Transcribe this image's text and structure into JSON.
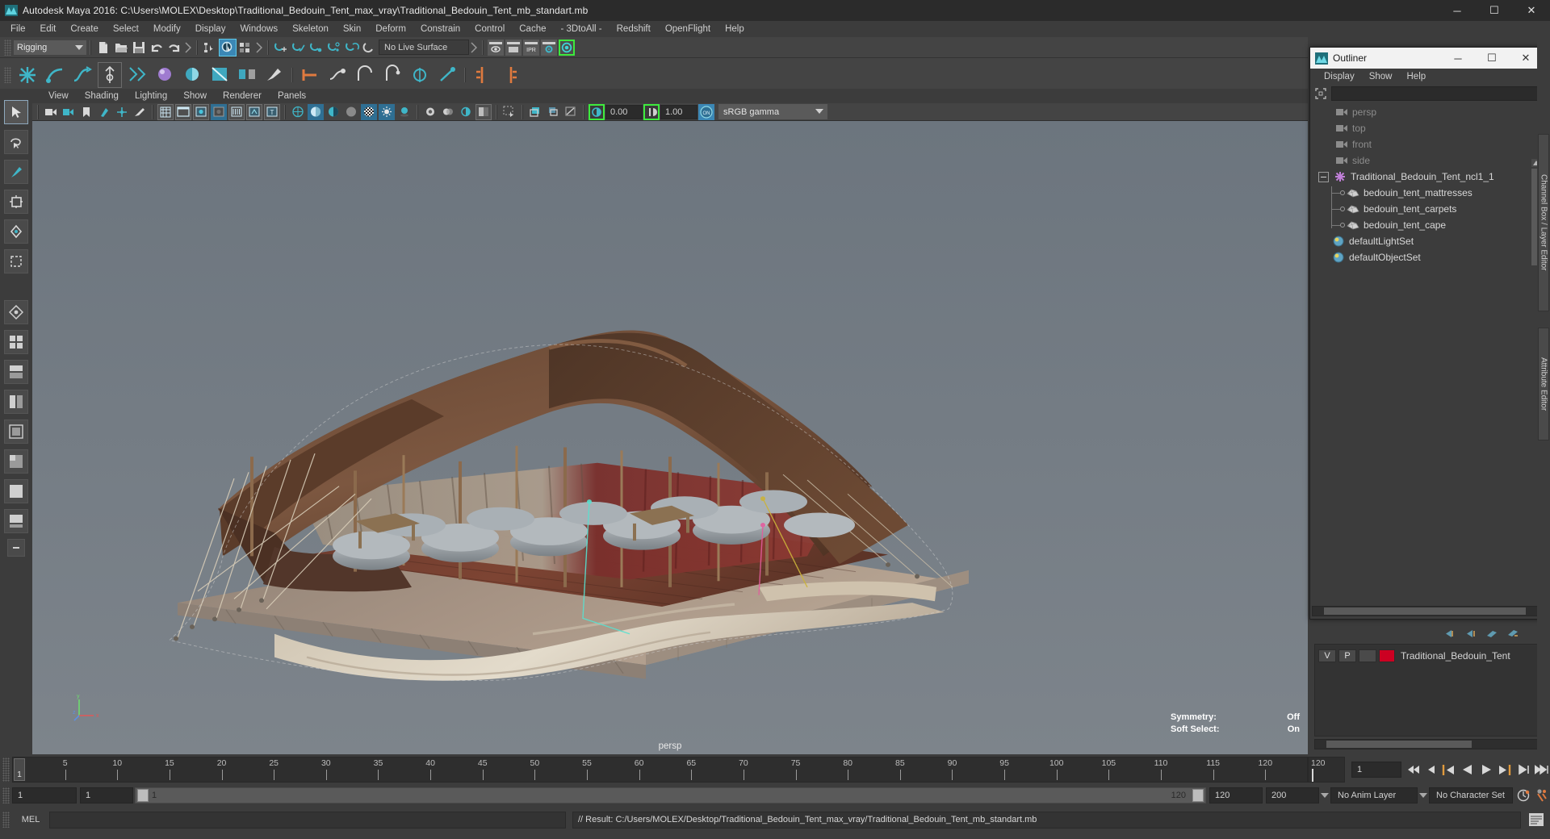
{
  "window": {
    "title": "Autodesk Maya 2016: C:\\Users\\MOLEX\\Desktop\\Traditional_Bedouin_Tent_max_vray\\Traditional_Bedouin_Tent_mb_standart.mb",
    "app_icon": "maya-icon",
    "minimize": "─",
    "maximize": "☐",
    "close": "✕"
  },
  "menubar": {
    "items": [
      "File",
      "Edit",
      "Create",
      "Select",
      "Modify",
      "Display",
      "Windows",
      "Skeleton",
      "Skin",
      "Deform",
      "Constrain",
      "Control",
      "Cache",
      "- 3DtoAll -",
      "Redshift",
      "OpenFlight",
      "Help"
    ]
  },
  "statusline": {
    "menuset_value": "Rigging",
    "live_surface": "No Live Surface",
    "icons": [
      "new-scene-icon",
      "open-scene-icon",
      "save-scene-icon",
      "undo-icon",
      "redo-icon",
      "select-by-hierarchy-icon",
      "select-by-object-icon",
      "select-by-component-icon",
      "snap-to-grid-icon",
      "snap-to-curve-icon",
      "snap-to-point-icon",
      "snap-to-projected-center-icon",
      "snap-to-view-planes-icon",
      "make-live-icon"
    ],
    "render_icons": [
      "render-current-frame-icon",
      "render-sequence-icon",
      "ipr-render-icon",
      "render-settings-icon",
      "render-globals-icon"
    ],
    "ipr_label": "IPR"
  },
  "shelf": {
    "icons": [
      "joint-tool-icon",
      "ik-handle-tool-icon",
      "ik-spline-handle-icon",
      "insert-joint-tool-icon",
      "skeleton-tool-icon",
      "bind-skin-icon",
      "interactive-bind-icon",
      "smooth-bind-icon",
      "detach-skin-icon",
      "paint-weights-icon",
      "parent-constraint-icon",
      "point-constraint-icon",
      "orient-constraint-icon",
      "scale-constraint-icon",
      "aim-constraint-icon",
      "pole-vector-icon",
      "mirror-joint-icon",
      "orient-joint-icon"
    ]
  },
  "toolbox": {
    "tools": [
      "select-tool",
      "lasso-select-tool",
      "paint-select-tool",
      "move-tool",
      "rotate-tool",
      "scale-tool",
      "last-tool-used",
      "four-view-layout",
      "persp-outliner-layout",
      "persp-graph-layout",
      "hypershade-persp-layout",
      "persp-view-layout",
      "single-perspective-view",
      "two-pane-layout",
      "more-layouts"
    ],
    "active_tool": "select-tool"
  },
  "viewport": {
    "menus": [
      "View",
      "Shading",
      "Lighting",
      "Show",
      "Renderer",
      "Panels"
    ],
    "toolbar_icons": [
      "select-camera-icon",
      "camera-attributes-icon",
      "bookmark-icon",
      "image-plane-icon",
      "two-dimensional-pan-zoom-icon",
      "grease-pencil-icon",
      "grid-icon",
      "film-gate-icon",
      "resolution-gate-icon",
      "gate-mask-icon",
      "field-chart-icon",
      "safe-action-icon",
      "safe-title-icon",
      "wireframe-icon",
      "smooth-shade-all-icon",
      "smooth-shade-selected-icon",
      "flat-shade-icon",
      "shaded-wireframe-icon",
      "textured-icon",
      "use-default-lighting-icon",
      "shadows-icon",
      "screen-space-ao-icon",
      "motion-blur-icon",
      "multisample-icon",
      "depth-of-field-icon",
      "isolate-select-icon",
      "xray-icon",
      "xray-joints-icon",
      "xray-active-components-icon",
      "exposure-icon",
      "gamma-icon",
      "view-transform-icon"
    ],
    "exposure_value": "0.00",
    "gamma_value": "1.00",
    "color_transform": "sRGB gamma",
    "toggle_on_label": "ON",
    "camera_label": "persp",
    "hud": [
      {
        "label": "Symmetry:",
        "value": "Off"
      },
      {
        "label": "Soft Select:",
        "value": "On"
      }
    ],
    "axis": {
      "y": "y",
      "x": "x",
      "z": "z"
    }
  },
  "outliner": {
    "title": "Outliner",
    "window_icon": "maya-outliner-icon",
    "minimize": "─",
    "maximize": "☐",
    "close": "✕",
    "menus": [
      "Display",
      "Show",
      "Help"
    ],
    "search_icon": "search-filter-icon",
    "search_value": "",
    "items": [
      {
        "label": "persp",
        "icon": "camera-icon",
        "indent": 1,
        "dim": true,
        "type": "camera"
      },
      {
        "label": "top",
        "icon": "camera-icon",
        "indent": 1,
        "dim": true,
        "type": "camera"
      },
      {
        "label": "front",
        "icon": "camera-icon",
        "indent": 1,
        "dim": true,
        "type": "camera"
      },
      {
        "label": "side",
        "icon": "camera-icon",
        "indent": 1,
        "dim": true,
        "type": "camera"
      },
      {
        "label": "Traditional_Bedouin_Tent_ncl1_1",
        "icon": "ncloth-icon",
        "indent": 0,
        "dim": false,
        "type": "ncloth",
        "expanded": true
      },
      {
        "label": "bedouin_tent_mattresses",
        "icon": "mesh-icon",
        "indent": 2,
        "dim": false,
        "type": "mesh"
      },
      {
        "label": "bedouin_tent_carpets",
        "icon": "mesh-icon",
        "indent": 2,
        "dim": false,
        "type": "mesh"
      },
      {
        "label": "bedouin_tent_cape",
        "icon": "mesh-icon",
        "indent": 2,
        "dim": false,
        "type": "mesh"
      },
      {
        "label": "defaultLightSet",
        "icon": "set-icon",
        "indent": 1,
        "dim": false,
        "type": "set"
      },
      {
        "label": "defaultObjectSet",
        "icon": "set-icon",
        "indent": 1,
        "dim": false,
        "type": "set"
      }
    ]
  },
  "layer_editor": {
    "buttons": [
      "layer-move-up-icon",
      "layer-move-down-icon",
      "layer-sort-icon",
      "layer-options-icon"
    ],
    "layers": [
      {
        "visible": "V",
        "playback": "P",
        "type": "",
        "color": "#cc0022",
        "name": "Traditional_Bedouin_Tent"
      }
    ]
  },
  "vtabs": [
    {
      "label": "Channel Box / Layer Editor"
    },
    {
      "label": "Attribute Editor"
    }
  ],
  "timeline": {
    "ticks": [
      5,
      10,
      15,
      20,
      25,
      30,
      35,
      40,
      45,
      50,
      55,
      60,
      65,
      70,
      75,
      80,
      85,
      90,
      95,
      100,
      105,
      110,
      115,
      120
    ],
    "current_frame": "1",
    "end_marker": "120",
    "frame_field": "1",
    "playback_buttons": [
      "go-to-start-icon",
      "step-back-keyframe-icon",
      "step-back-frame-icon",
      "play-backwards-icon",
      "play-forwards-icon",
      "step-forward-frame-icon",
      "step-forward-keyframe-icon",
      "go-to-end-icon"
    ]
  },
  "range": {
    "start": "1",
    "range_start": "1",
    "slider_start_label": "1",
    "slider_end_label": "120",
    "range_end": "120",
    "end": "200",
    "anim_layer": "No Anim Layer",
    "character_set": "No Character Set",
    "auto_key_icon": "auto-keyframe-icon",
    "anim_prefs_icon": "animation-preferences-icon"
  },
  "command_line": {
    "language": "MEL",
    "input_value": "",
    "result": "// Result: C:/Users/MOLEX/Desktop/Traditional_Bedouin_Tent_max_vray/Traditional_Bedouin_Tent_mb_standart.mb",
    "script_editor_icon": "script-editor-icon"
  },
  "colors": {
    "accent_blue": "#3b87b5",
    "highlight_green": "#3dea3d",
    "panel_bg": "#3c3c3c",
    "toolbar_bg": "#444444",
    "field_bg": "#2b2b2b",
    "layer_color": "#cc0022"
  }
}
